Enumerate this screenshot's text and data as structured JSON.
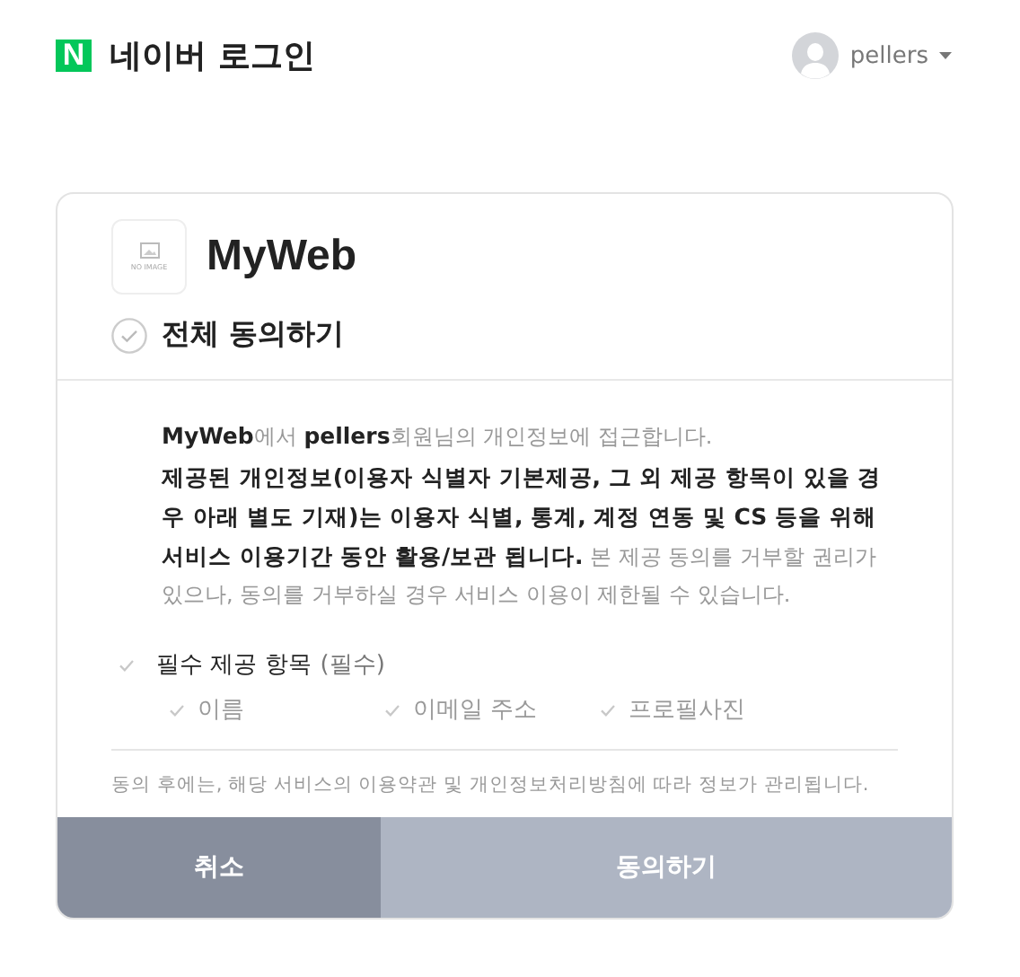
{
  "header": {
    "logo": "N",
    "title": "네이버 로그인",
    "user": "pellers"
  },
  "app": {
    "logo_text": "NO IMAGE",
    "name": "MyWeb"
  },
  "agree_all": {
    "label": "전체 동의하기",
    "checked": false
  },
  "intro": [
    "**MyWeb**에서 **pellers**회원님의 개인정보에 접근합니다.",
    "**제공된 개인정보(이용자 식별자 기본제공, 그 외 제공 항목이 있을 경우 아래 별도 기재)는 이용자 식별, 통계, 계정 연동 및 CS 등을 위해 서비스 이용기간 동안 활용/보관 됩니다.** 본 제공 동의를 거부할 권리가 있으나, 동의를 거부하실 경우 서비스 이용이 제한될 수 있습니다."
  ],
  "required": {
    "label": "필수 제공 항목",
    "suffix": "(필수)",
    "checked": false,
    "items": [
      {
        "label": "이름",
        "checked": false
      },
      {
        "label": "이메일 주소",
        "checked": false
      },
      {
        "label": "프로필사진",
        "checked": false
      }
    ]
  },
  "notice": "동의 후에는, 해당 서비스의 이용약관 및 개인정보처리방침에 따라 정보가 관리됩니다.",
  "buttons": [
    {
      "label": "취소",
      "kind": "cancel",
      "disabled": false
    },
    {
      "label": "동의하기",
      "kind": "confirm",
      "disabled": true
    }
  ]
}
